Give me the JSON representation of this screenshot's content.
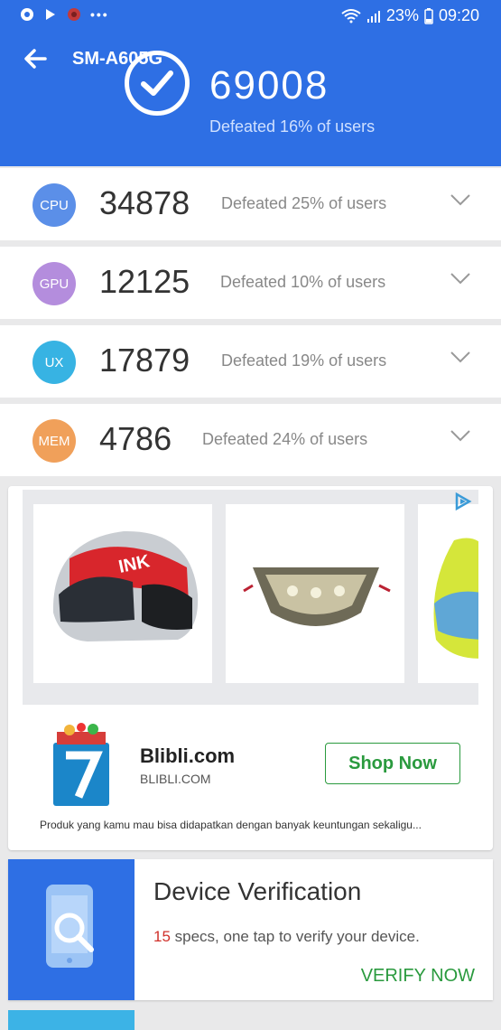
{
  "status_bar": {
    "dots": "•••",
    "battery_percent": "23%",
    "time": "09:20"
  },
  "header": {
    "title": "SM-A605G",
    "total_score": "69008",
    "total_defeated": "Defeated 16% of users"
  },
  "scores": [
    {
      "badge": "CPU",
      "score": "34878",
      "defeated": "Defeated 25% of users",
      "color": "#5b8fe8"
    },
    {
      "badge": "GPU",
      "score": "12125",
      "defeated": "Defeated 10% of users",
      "color": "#b48ddd"
    },
    {
      "badge": "UX",
      "score": "17879",
      "defeated": "Defeated 19% of users",
      "color": "#37b3e3"
    },
    {
      "badge": "MEM",
      "score": "4786",
      "defeated": "Defeated 24% of users",
      "color": "#f0a05a"
    }
  ],
  "ad": {
    "brand": "Blibli.com",
    "domain": "BLIBLI.COM",
    "cta": "Shop Now",
    "description": "Produk yang kamu mau bisa didapatkan dengan banyak keuntungan sekaligu..."
  },
  "verification": {
    "title": "Device Verification",
    "count": "15",
    "text": " specs, one tap to verify your device.",
    "button": "VERIFY NOW"
  },
  "colors": {
    "primary": "#2e6fe4",
    "accent_green": "#2a9a3e",
    "accent_red": "#d0302a"
  }
}
